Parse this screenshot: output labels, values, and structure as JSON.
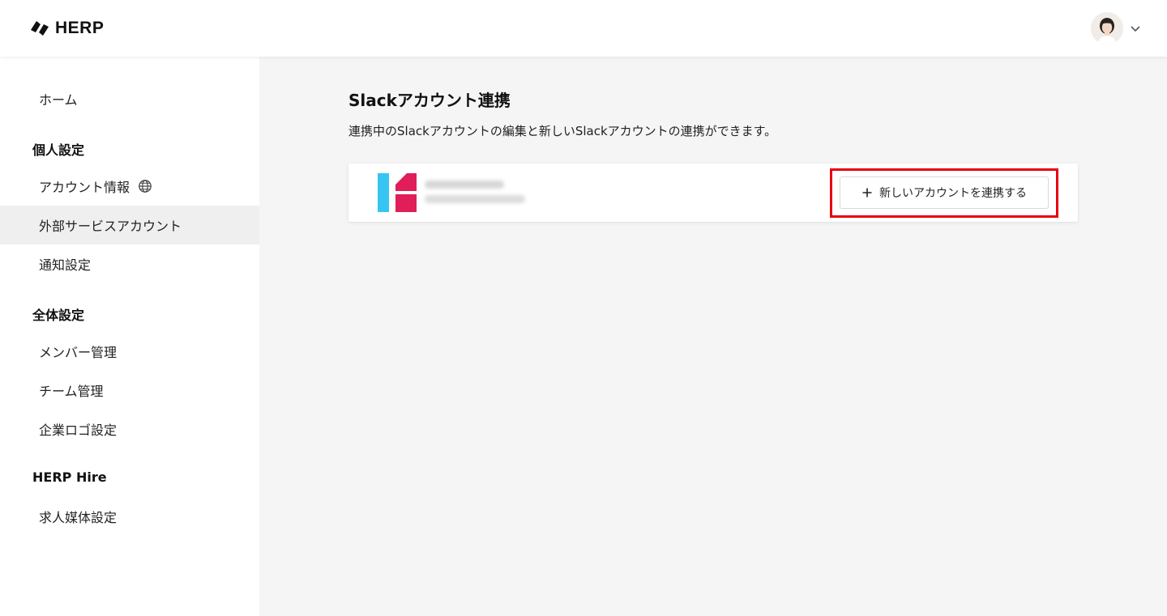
{
  "header": {
    "logo_text": "HERP",
    "logo_icon": "herp-logo-mark",
    "avatar_icon": "user-avatar",
    "menu_icon": "chevron-down-icon"
  },
  "sidebar": {
    "home": "ホーム",
    "personal_heading": "個人設定",
    "account_info": "アカウント情報",
    "account_info_icon": "globe-icon",
    "external_accounts": "外部サービスアカウント",
    "notifications": "通知設定",
    "global_heading": "全体設定",
    "members": "メンバー管理",
    "teams": "チーム管理",
    "company_logo": "企業ロゴ設定",
    "hire_heading": "HERP Hire",
    "job_media": "求人媒体設定"
  },
  "main": {
    "title": "Slackアカウント連携",
    "description": "連携中のSlackアカウントの編集と新しいSlackアカウントの連携ができます。",
    "add_account_label": "新しいアカウントを連携する",
    "add_icon": "plus-icon"
  },
  "colors": {
    "accent_red": "#e60012",
    "slack_blue": "#36c5f0",
    "slack_red": "#e01e5a"
  }
}
